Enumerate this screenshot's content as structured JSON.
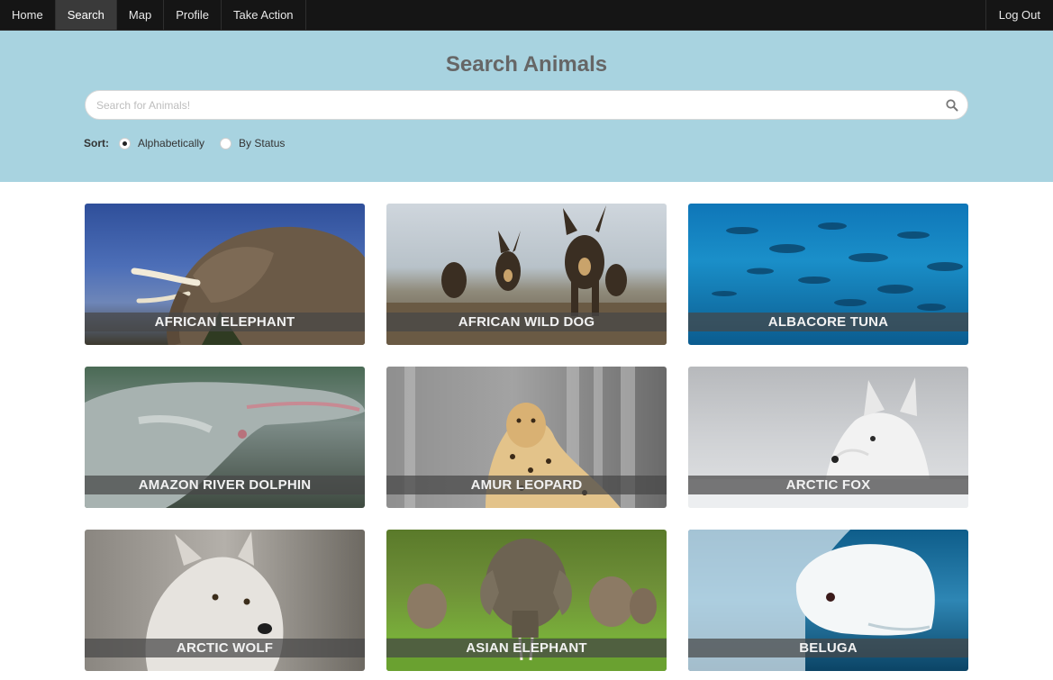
{
  "nav": {
    "items": [
      {
        "label": "Home"
      },
      {
        "label": "Search"
      },
      {
        "label": "Map"
      },
      {
        "label": "Profile"
      },
      {
        "label": "Take Action"
      }
    ],
    "active": "Search",
    "logout_label": "Log Out"
  },
  "hero": {
    "title": "Search Animals",
    "search": {
      "placeholder": "Search for Animals!",
      "value": ""
    },
    "sort": {
      "label": "Sort:",
      "options": [
        {
          "label": "Alphabetically",
          "checked": true
        },
        {
          "label": "By Status",
          "checked": false
        }
      ]
    }
  },
  "animals": [
    {
      "name": "AFRICAN ELEPHANT"
    },
    {
      "name": "AFRICAN WILD DOG"
    },
    {
      "name": "ALBACORE TUNA"
    },
    {
      "name": "AMAZON RIVER DOLPHIN"
    },
    {
      "name": "AMUR LEOPARD"
    },
    {
      "name": "ARCTIC FOX"
    },
    {
      "name": "ARCTIC WOLF"
    },
    {
      "name": "ASIAN ELEPHANT"
    },
    {
      "name": "BELUGA"
    }
  ],
  "colors": {
    "navbar": "#151515",
    "hero_bg": "#a8d3e0",
    "title": "#666666"
  },
  "icons": {
    "search": "magnifier-icon"
  }
}
